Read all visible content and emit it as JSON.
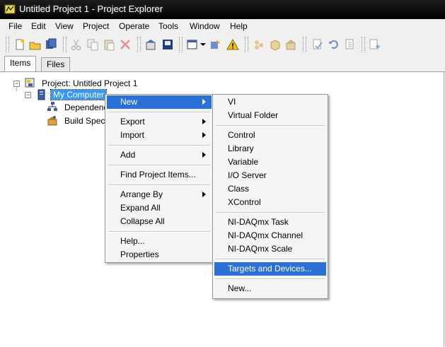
{
  "window": {
    "title": "Untitled Project 1 - Project Explorer"
  },
  "menubar": [
    "File",
    "Edit",
    "View",
    "Project",
    "Operate",
    "Tools",
    "Window",
    "Help"
  ],
  "toolbar": {
    "buttons": [
      "new-icon",
      "open-icon",
      "save-all-icon",
      "cut-icon",
      "copy-icon",
      "paste-icon",
      "delete-icon",
      "build-icon",
      "deploy-icon",
      "view-icon",
      "properties-icon",
      "warning-icon",
      "library-icon",
      "class-icon",
      "package-icon",
      "check-icon",
      "undo-icon",
      "dependencies-icon",
      "add-file-icon"
    ]
  },
  "tabs": [
    {
      "label": "Items",
      "active": true
    },
    {
      "label": "Files",
      "active": false
    }
  ],
  "tree": {
    "project": "Project: Untitled Project 1",
    "computer": "My Computer",
    "dependencies": "Dependenc",
    "build": "Build Speci"
  },
  "context_menu": {
    "items": [
      "New",
      "Export",
      "Import",
      "Add",
      "Find Project Items...",
      "Arrange By",
      "Expand All",
      "Collapse All",
      "Help...",
      "Properties"
    ]
  },
  "submenu": {
    "items": [
      "VI",
      "Virtual Folder",
      "Control",
      "Library",
      "Variable",
      "I/O Server",
      "Class",
      "XControl",
      "NI-DAQmx Task",
      "NI-DAQmx Channel",
      "NI-DAQmx Scale",
      "Targets and Devices...",
      "New..."
    ]
  },
  "colors": {
    "highlight": "#2a70d6",
    "selected_tree": "#3399ff",
    "title_bar": "#000000"
  }
}
